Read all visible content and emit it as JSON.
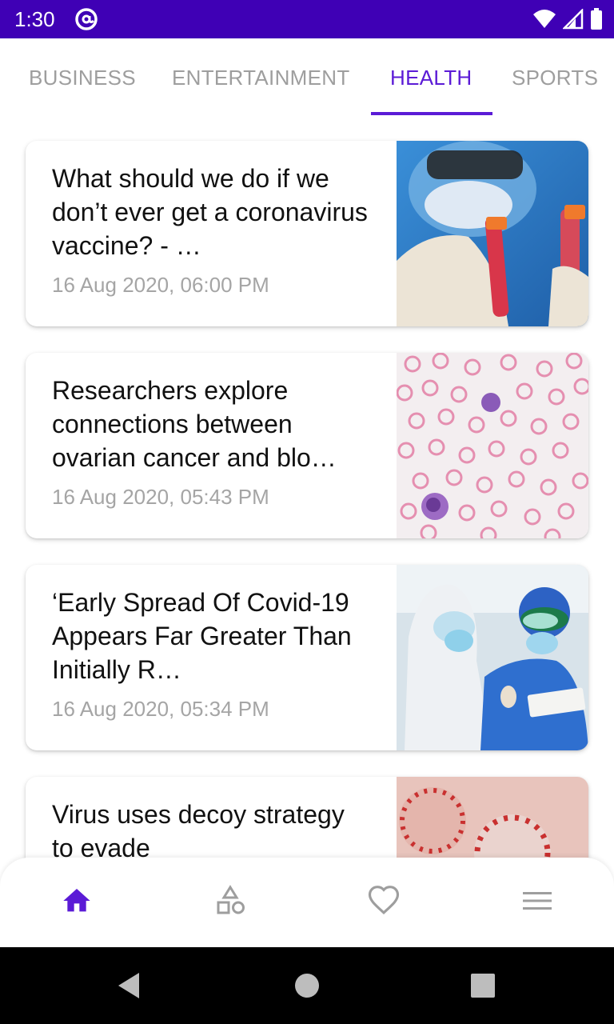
{
  "status_bar": {
    "time": "1:30",
    "notification_icon": "at-sign-icon",
    "icons": [
      "wifi-icon",
      "signal-icon",
      "battery-icon"
    ]
  },
  "tabs": [
    {
      "label": "BUSINESS"
    },
    {
      "label": "ENTERTAINMENT"
    },
    {
      "label": "HEALTH",
      "active": true
    },
    {
      "label": "SPORTS"
    }
  ],
  "articles": [
    {
      "title": "What should we do if we don’t ever get a coronavirus vaccine? - …",
      "date": "16 Aug 2020, 06:00 PM",
      "image": "lab-scientist-test-tubes"
    },
    {
      "title": "Researchers explore connections between ovarian cancer and blo…",
      "date": "16 Aug 2020, 05:43 PM",
      "image": "blood-cells-microscope"
    },
    {
      "title": "‘Early Spread Of Covid-19 Appears Far Greater Than Initially R…",
      "date": "16 Aug 2020, 05:34 PM",
      "image": "medical-workers-ppe"
    },
    {
      "title": "Virus uses decoy strategy to evade",
      "date": "",
      "image": "virus-particles"
    }
  ],
  "bottom_nav": [
    {
      "icon": "home-icon",
      "active": true
    },
    {
      "icon": "categories-icon"
    },
    {
      "icon": "heart-icon"
    },
    {
      "icon": "menu-icon"
    }
  ],
  "colors": {
    "primary": "#5b1bd6",
    "status_bar": "#3f00b5",
    "inactive": "#9e9e9e"
  }
}
